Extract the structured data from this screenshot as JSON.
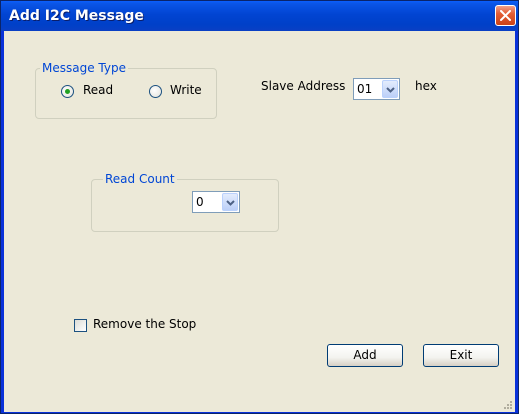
{
  "window": {
    "title": "Add I2C Message"
  },
  "message_type": {
    "legend": "Message Type",
    "options": [
      {
        "label": "Read",
        "selected": true
      },
      {
        "label": "Write",
        "selected": false
      }
    ]
  },
  "slave_address": {
    "label": "Slave Address",
    "value": "01",
    "unit": "hex"
  },
  "read_count": {
    "legend": "Read Count",
    "value": "0"
  },
  "remove_stop": {
    "label": "Remove the Stop",
    "checked": false
  },
  "buttons": {
    "add": "Add",
    "exit": "Exit"
  },
  "colors": {
    "title_bar": "#0144d2",
    "dialog_face": "#ece9d8",
    "group_legend": "#0046d5",
    "radio_dot": "#21a121",
    "close_button": "#e35d35"
  }
}
